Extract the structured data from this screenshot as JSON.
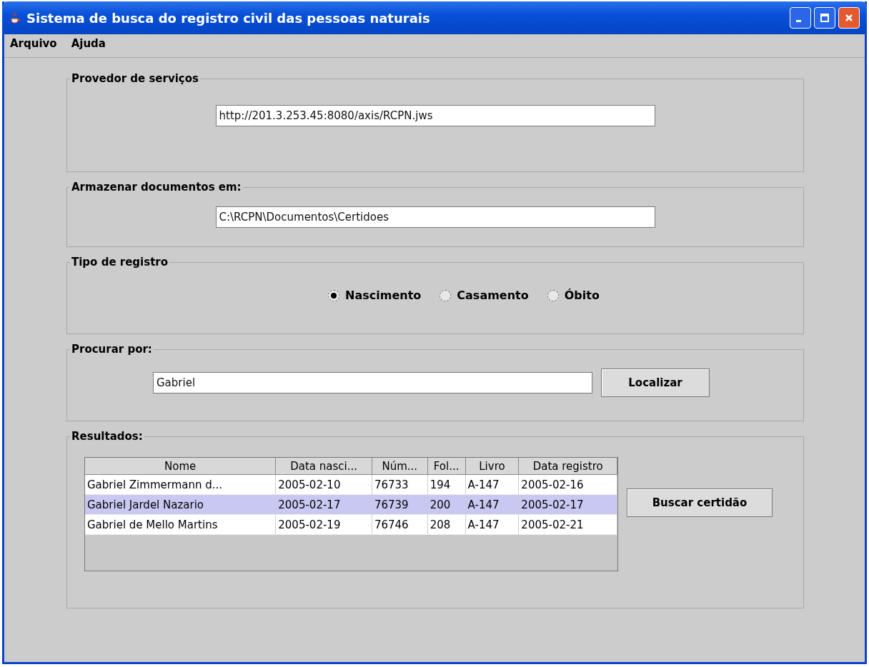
{
  "window": {
    "title": "Sistema de busca do registro civil das pessoas naturais"
  },
  "menu": [
    "Arquivo",
    "Ajuda"
  ],
  "provider": {
    "legend": "Provedor de serviços",
    "value": "http://201.3.253.45:8080/axis/RCPN.jws"
  },
  "storage": {
    "legend": "Armazenar documentos em:",
    "value": "C:\\RCPN\\Documentos\\Certidoes"
  },
  "record_type": {
    "legend": "Tipo de registro",
    "options": [
      {
        "label": "Nascimento",
        "selected": true
      },
      {
        "label": "Casamento",
        "selected": false
      },
      {
        "label": "Óbito",
        "selected": false
      }
    ]
  },
  "search": {
    "legend": "Procurar por:",
    "value": "Gabriel",
    "button": "Localizar"
  },
  "results": {
    "legend": "Resultados:",
    "button": "Buscar certidão",
    "columns": [
      "Nome",
      "Data nasci...",
      "Núm...",
      "Fol...",
      "Livro",
      "Data registro"
    ],
    "rows": [
      {
        "cells": [
          "Gabriel Zimmermann d...",
          "2005-02-10",
          "76733",
          "194",
          "A-147",
          "2005-02-16"
        ],
        "selected": false
      },
      {
        "cells": [
          "Gabriel Jardel Nazario",
          "2005-02-17",
          "76739",
          "200",
          "A-147",
          "2005-02-17"
        ],
        "selected": true
      },
      {
        "cells": [
          "Gabriel de Mello Martins",
          "2005-02-19",
          "76746",
          "208",
          "A-147",
          "2005-02-21"
        ],
        "selected": false
      }
    ]
  }
}
